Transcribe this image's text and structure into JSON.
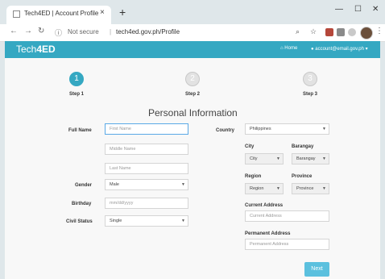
{
  "browser": {
    "tab_title": "Tech4ED | Account Profile",
    "tab_close": "×",
    "new_tab": "+",
    "minimize": "—",
    "maximize": "☐",
    "close": "✕",
    "url_secure": "Not secure",
    "url_separator": "|",
    "url": "tech4ed.gov.ph/Profile"
  },
  "app": {
    "brand_prefix": "Tech",
    "brand_bold": "4ED",
    "nav_home": "Home",
    "nav_user": "account@email.gov.ph"
  },
  "steps": [
    {
      "number": "1",
      "label": "Step 1"
    },
    {
      "number": "2",
      "label": "Step 2"
    },
    {
      "number": "3",
      "label": "Step 3"
    }
  ],
  "form": {
    "title": "Personal Information",
    "full_name_label": "Full Name",
    "first_name_placeholder": "First Name",
    "middle_name_placeholder": "Middle Name",
    "last_name_placeholder": "Last Name",
    "gender_label": "Gender",
    "gender_value": "Male",
    "birthday_label": "Birthday",
    "birthday_placeholder": "mm/dd/yyyy",
    "civil_status_label": "Civil Status",
    "civil_status_value": "Single",
    "country_label": "Country",
    "country_value": "Philippines",
    "city_label": "City",
    "city_value": "City",
    "barangay_label": "Barangay",
    "barangay_value": "Barangay",
    "region_label": "Region",
    "region_value": "Region",
    "province_label": "Province",
    "province_value": "Province",
    "current_address_label": "Current Address",
    "current_address_placeholder": "Current Address",
    "permanent_address_label": "Permanent Address",
    "permanent_address_placeholder": "Permanent Address",
    "next_label": "Next"
  },
  "colors": {
    "accent": "#35a8c2",
    "next_button": "#5bc0de"
  }
}
